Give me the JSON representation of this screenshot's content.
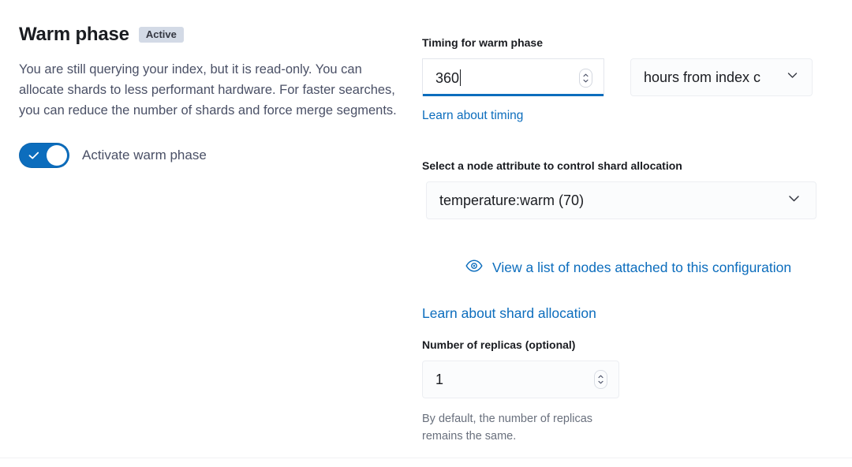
{
  "phase": {
    "title": "Warm phase",
    "badge": "Active",
    "description": "You are still querying your index, but it is read-only. You can allocate shards to less performant hardware. For faster searches, you can reduce the number of shards and force merge segments.",
    "activate_toggle_label": "Activate warm phase",
    "activate_toggle_state": "on"
  },
  "timing": {
    "label": "Timing for warm phase",
    "value": "360",
    "placeholder": "",
    "units_selected": "hours from index c",
    "learn_link": "Learn about timing"
  },
  "allocation": {
    "label": "Select a node attribute to control shard allocation",
    "selected": "temperature:warm (70)",
    "view_nodes_link": "View a list of nodes attached to this configuration",
    "learn_link": "Learn about shard allocation"
  },
  "replicas": {
    "label": "Number of replicas (optional)",
    "value": "1",
    "hint": "By default, the number of replicas remains the same."
  },
  "icons": {
    "eye": "eye-icon",
    "chevron_down": "chevron-down-icon",
    "spinner": "number-spinner-icon",
    "check": "check-icon"
  },
  "colors": {
    "accent": "#0c6dbd",
    "badge_bg": "#d3dae6",
    "text": "#343741",
    "muted_text": "#69707d"
  }
}
